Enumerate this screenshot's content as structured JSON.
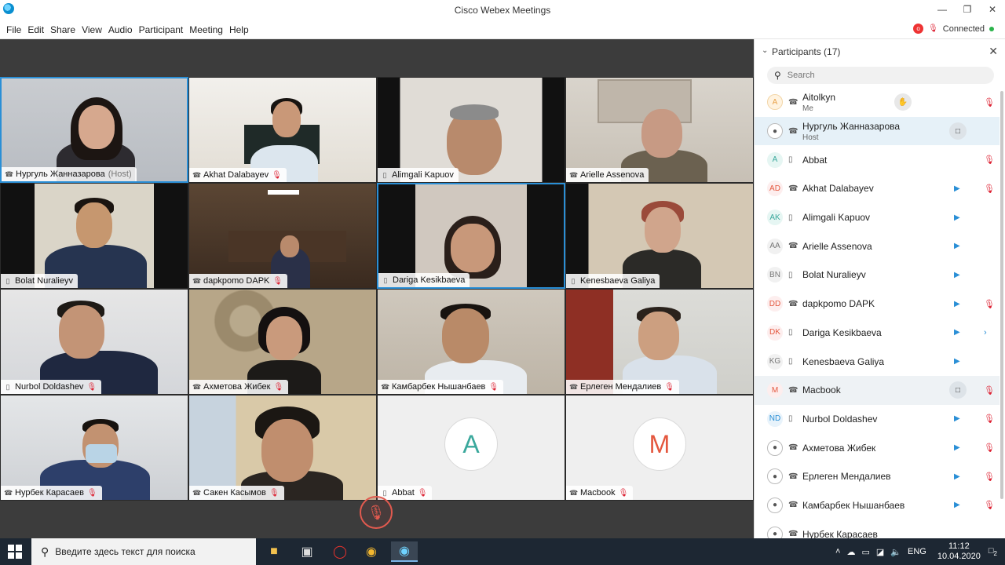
{
  "window": {
    "title": "Cisco Webex Meetings"
  },
  "menu": [
    "File",
    "Edit",
    "Share",
    "View",
    "Audio",
    "Participant",
    "Meeting",
    "Help"
  ],
  "status": {
    "connection": "Connected",
    "recording_badge": "o"
  },
  "tiles": [
    {
      "name": "Нургуль  Жанназарова",
      "host_tag": "(Host)"
    },
    {
      "name": "Akhat Dalabayev"
    },
    {
      "name": "Alimgali Kapuov"
    },
    {
      "name": "Arielle Assenova"
    },
    {
      "name": "Bolat Nuralieyv"
    },
    {
      "name": "dapkpomo DAPK"
    },
    {
      "name": "Dariga Kesikbaeva"
    },
    {
      "name": "Kenesbaeva Galiya"
    },
    {
      "name": "Nurbol Doldashev"
    },
    {
      "name": "Ахметова Жибек"
    },
    {
      "name": "Камбарбек Нышанбаев"
    },
    {
      "name": "Ерлеген Мендалиев"
    },
    {
      "name": "Нурбек Карасаев"
    },
    {
      "name": "Сакен Касымов"
    },
    {
      "name": "Abbat",
      "avatar": "A"
    },
    {
      "name": "Macbook",
      "avatar": "M"
    }
  ],
  "panel": {
    "title": "Participants (17)",
    "search_placeholder": "Search",
    "participants": [
      {
        "initials": "A",
        "name": "Aitolkyn",
        "sub": "Me"
      },
      {
        "initials": "",
        "name": "Нургуль  Жанназарова",
        "sub": "Host"
      },
      {
        "initials": "A",
        "name": "Abbat",
        "sub": ""
      },
      {
        "initials": "AD",
        "name": "Akhat Dalabayev",
        "sub": ""
      },
      {
        "initials": "AK",
        "name": "Alimgali Kapuov",
        "sub": ""
      },
      {
        "initials": "AA",
        "name": "Arielle Assenova",
        "sub": ""
      },
      {
        "initials": "BN",
        "name": "Bolat Nuralieyv",
        "sub": ""
      },
      {
        "initials": "DD",
        "name": "dapkpomo DAPK",
        "sub": ""
      },
      {
        "initials": "DK",
        "name": "Dariga Kesikbaeva",
        "sub": ""
      },
      {
        "initials": "KG",
        "name": "Kenesbaeva Galiya",
        "sub": ""
      },
      {
        "initials": "M",
        "name": "Macbook",
        "sub": ""
      },
      {
        "initials": "ND",
        "name": "Nurbol Doldashev",
        "sub": ""
      },
      {
        "initials": "",
        "name": "Ахметова Жибек",
        "sub": ""
      },
      {
        "initials": "",
        "name": "Ерлеген Мендалиев",
        "sub": ""
      },
      {
        "initials": "",
        "name": "Камбарбек Нышанбаев",
        "sub": ""
      },
      {
        "initials": "",
        "name": "Нурбек Карасаев",
        "sub": ""
      }
    ]
  },
  "taskbar": {
    "search_text": "Введите здесь текст для поиска",
    "language": "ENG",
    "time": "11:12",
    "date": "10.04.2020",
    "notifications": "2"
  }
}
